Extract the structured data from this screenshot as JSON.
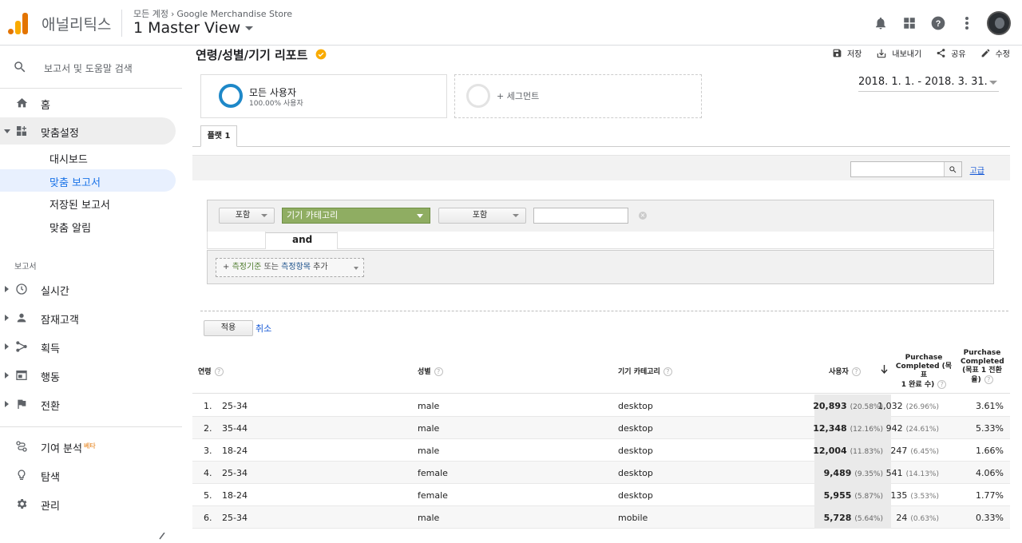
{
  "app": {
    "product_name": "애널리틱스",
    "breadcrumb_account": "모든 계정",
    "breadcrumb_property": "Google Merchandise Store",
    "view_name": "1 Master View"
  },
  "topbar_icons": [
    "bell-icon",
    "apps-grid-icon",
    "help-icon",
    "more-vert-icon",
    "avatar"
  ],
  "sidebar": {
    "search_placeholder": "보고서 및 도움말 검색",
    "home": "홈",
    "customization": "맞춤설정",
    "sub_items": [
      "대시보드",
      "맞춤 보고서",
      "저장된 보고서",
      "맞춤 알림"
    ],
    "reports_section": "보고서",
    "reports": [
      "실시간",
      "잠재고객",
      "획득",
      "행동",
      "전환"
    ],
    "attribution": "기여 분석",
    "attribution_badge": "베타",
    "discover": "탐색",
    "admin": "관리"
  },
  "report": {
    "title": "연령/성별/기기 리포트",
    "actions": {
      "save": "저장",
      "export": "내보내기",
      "share": "공유",
      "edit": "수정"
    },
    "segment_name": "모든 사용자",
    "segment_pct": "100.00% 사용자",
    "add_segment": "+ 세그먼트",
    "date_range": "2018. 1. 1. - 2018. 3. 31.",
    "tab": "플랫 1",
    "advanced_link": "고급"
  },
  "filter": {
    "include_1": "포함",
    "dimension": "기기 카테고리",
    "include_2": "포함",
    "value": "",
    "and_label": "and",
    "add_prefix": "+",
    "add_dimension": "측정기준",
    "add_or": "또는",
    "add_metric": "측정항목",
    "add_suffix": "추가",
    "apply": "적용",
    "cancel": "취소"
  },
  "table": {
    "headers": {
      "age": "연령",
      "gender": "성별",
      "device": "기기 카테고리",
      "users": "사용자",
      "purchase_completed": [
        "Purchase",
        "Completed (목표",
        "1 완료 수)"
      ],
      "purchase_rate": [
        "Purchase",
        "Completed",
        "(목표 1 전환",
        "율)"
      ]
    },
    "rows": [
      {
        "n": "1.",
        "age": "25-34",
        "gender": "male",
        "device": "desktop",
        "users": "20,893",
        "users_pct": "(20.58%)",
        "pc": "1,032",
        "pc_pct": "(26.96%)",
        "rate": "3.61%"
      },
      {
        "n": "2.",
        "age": "35-44",
        "gender": "male",
        "device": "desktop",
        "users": "12,348",
        "users_pct": "(12.16%)",
        "pc": "942",
        "pc_pct": "(24.61%)",
        "rate": "5.33%"
      },
      {
        "n": "3.",
        "age": "18-24",
        "gender": "male",
        "device": "desktop",
        "users": "12,004",
        "users_pct": "(11.83%)",
        "pc": "247",
        "pc_pct": "(6.45%)",
        "rate": "1.66%"
      },
      {
        "n": "4.",
        "age": "25-34",
        "gender": "female",
        "device": "desktop",
        "users": "9,489",
        "users_pct": "(9.35%)",
        "pc": "541",
        "pc_pct": "(14.13%)",
        "rate": "4.06%"
      },
      {
        "n": "5.",
        "age": "18-24",
        "gender": "female",
        "device": "desktop",
        "users": "5,955",
        "users_pct": "(5.87%)",
        "pc": "135",
        "pc_pct": "(3.53%)",
        "rate": "1.77%"
      },
      {
        "n": "6.",
        "age": "25-34",
        "gender": "male",
        "device": "mobile",
        "users": "5,728",
        "users_pct": "(5.64%)",
        "pc": "24",
        "pc_pct": "(0.63%)",
        "rate": "0.33%"
      }
    ]
  },
  "colors": {
    "accent_orange": "#f9ab00",
    "segment_blue": "#1e88c8",
    "dimension_green": "#8fad62",
    "link_blue": "#1558d6"
  }
}
